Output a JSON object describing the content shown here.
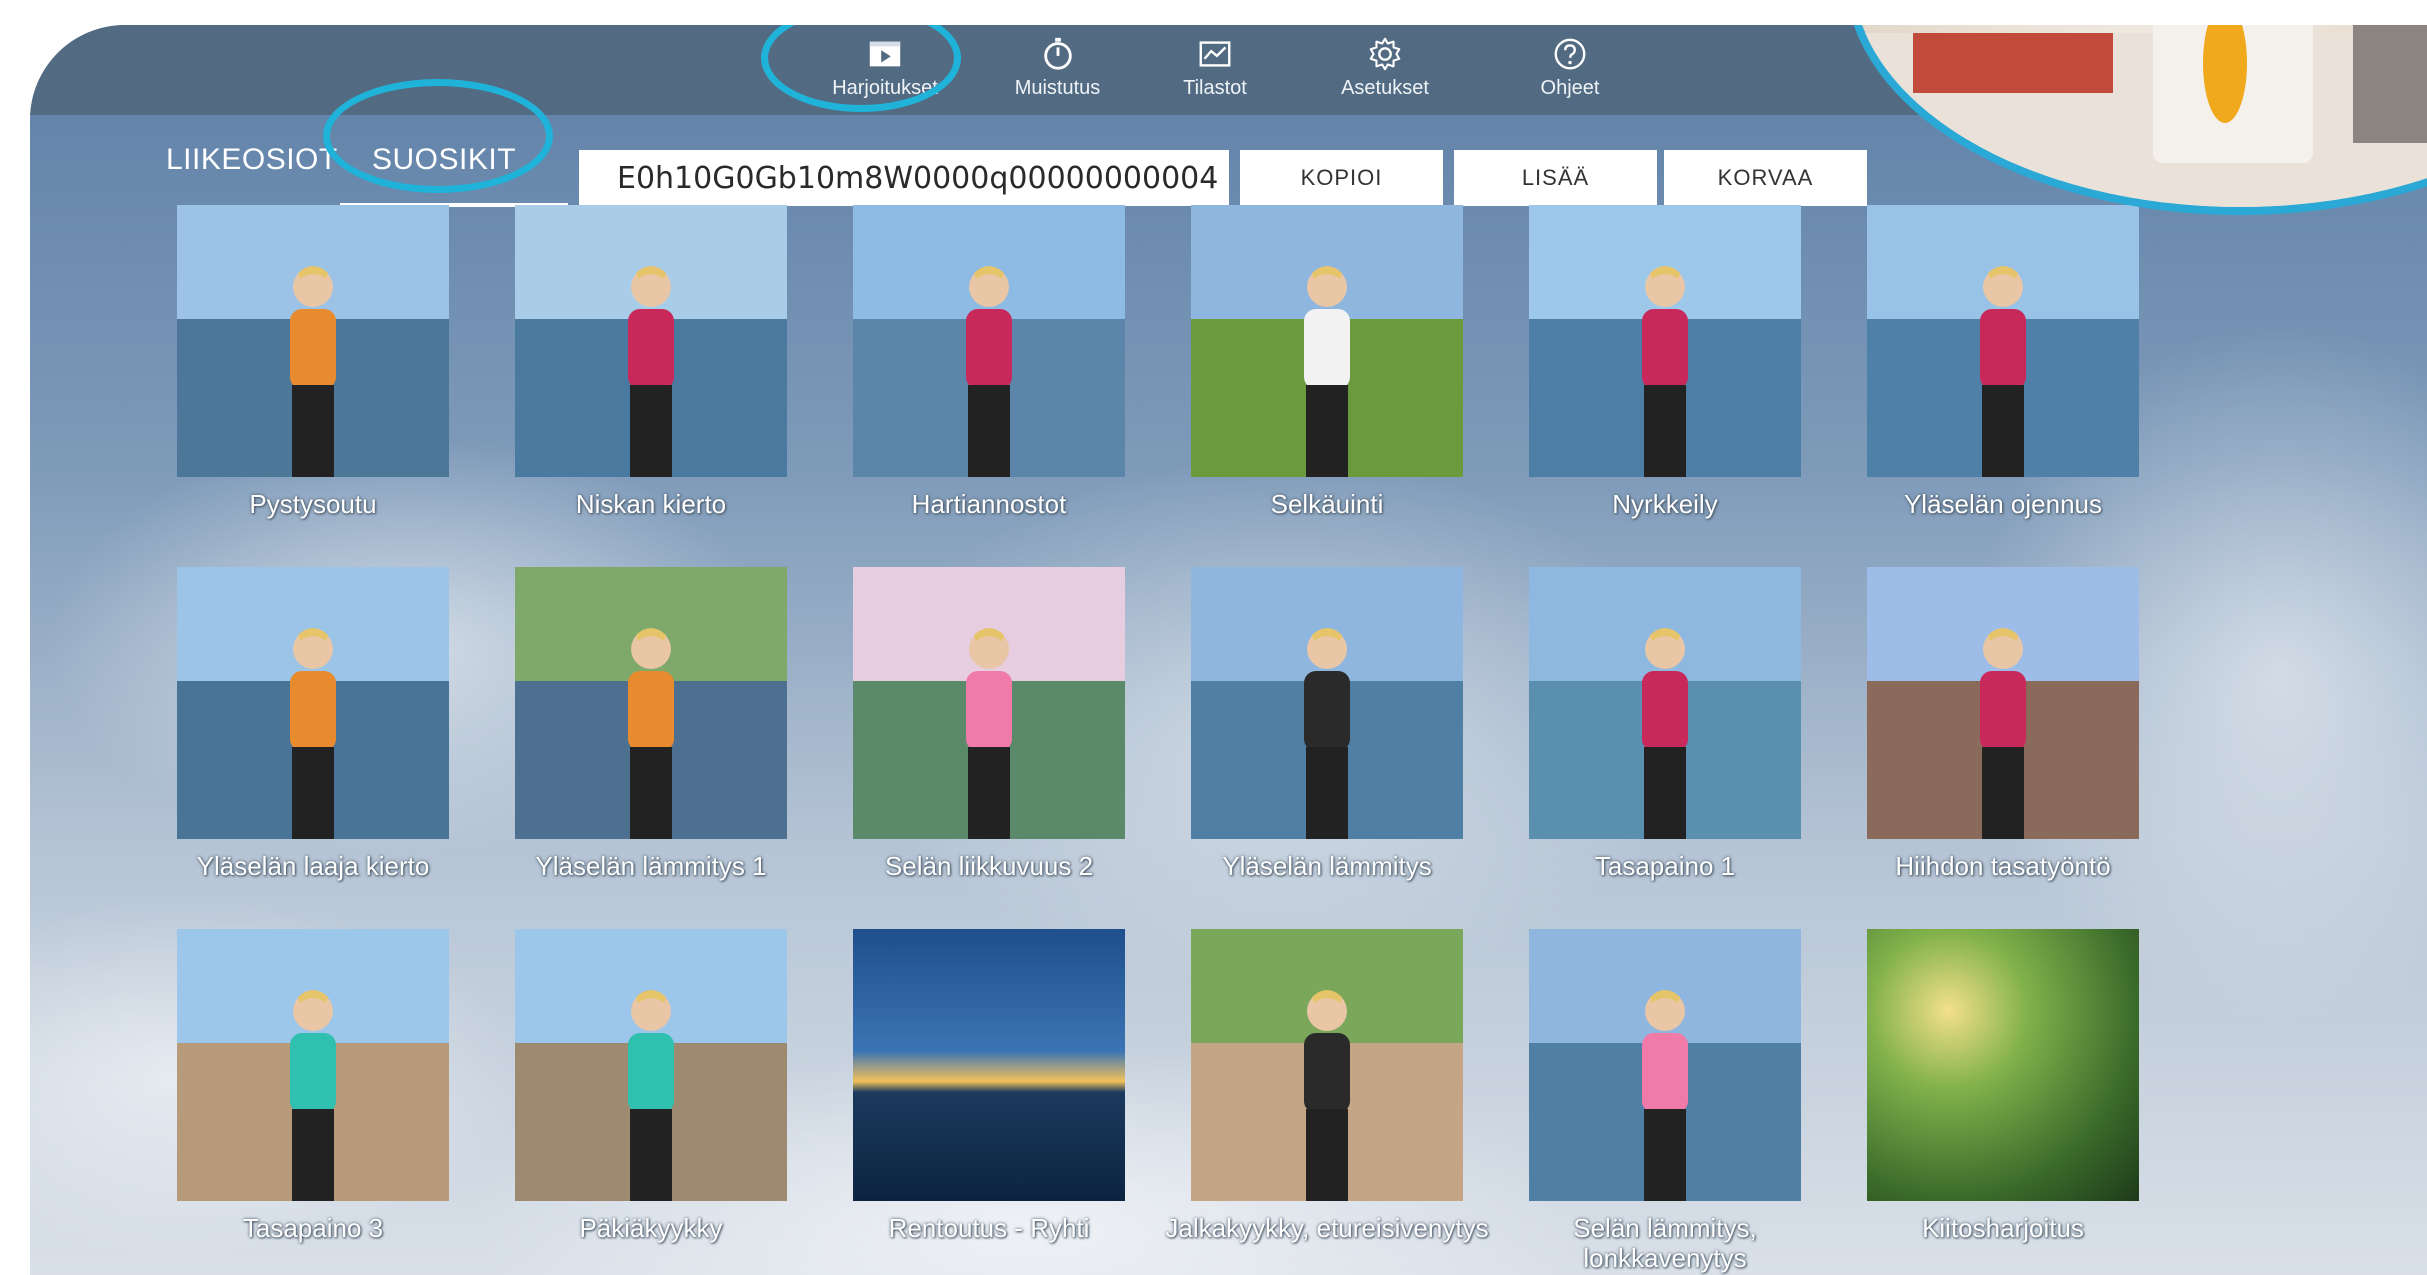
{
  "nav": {
    "items": [
      {
        "id": "harjoitukset",
        "label": "Harjoitukset",
        "icon": "play-window-icon"
      },
      {
        "id": "muistutus",
        "label": "Muistutus",
        "icon": "stopwatch-icon"
      },
      {
        "id": "tilastot",
        "label": "Tilastot",
        "icon": "chart-icon"
      },
      {
        "id": "asetukset",
        "label": "Asetukset",
        "icon": "gear-icon"
      },
      {
        "id": "ohjeet",
        "label": "Ohjeet",
        "icon": "help-icon"
      }
    ]
  },
  "subnav": {
    "tabs": [
      {
        "label": "LIIKEOSIOT",
        "active": false
      },
      {
        "label": "SUOSIKIT",
        "active": true
      }
    ],
    "code_value": "E0h10G0Gb10m8W0000q00000000004",
    "buttons": {
      "copy": "KOPIOI",
      "add": "LISÄÄ",
      "replace": "KORVAA"
    }
  },
  "exercises": [
    {
      "name": "Pystysoutu"
    },
    {
      "name": "Niskan kierto"
    },
    {
      "name": "Hartiannostot"
    },
    {
      "name": "Selkäuinti"
    },
    {
      "name": "Nyrkkeily"
    },
    {
      "name": "Yläselän ojennus"
    },
    {
      "name": "Yläselän laaja kierto"
    },
    {
      "name": "Yläselän lämmitys 1"
    },
    {
      "name": "Selän liikkuvuus 2"
    },
    {
      "name": "Yläselän lämmitys"
    },
    {
      "name": "Tasapaino 1"
    },
    {
      "name": "Hiihdon tasatyöntö"
    },
    {
      "name": "Tasapaino 3"
    },
    {
      "name": "Päkiäkyykky"
    },
    {
      "name": "Rentoutus - Ryhti"
    },
    {
      "name": "Jalkakyykky, etureisivenytys"
    },
    {
      "name": "Selän lämmitys, lonkkavenytys"
    },
    {
      "name": "Kiitosharjoitus"
    }
  ],
  "colors": {
    "topbar": "#536b82",
    "highlight": "#1fb3d9"
  }
}
